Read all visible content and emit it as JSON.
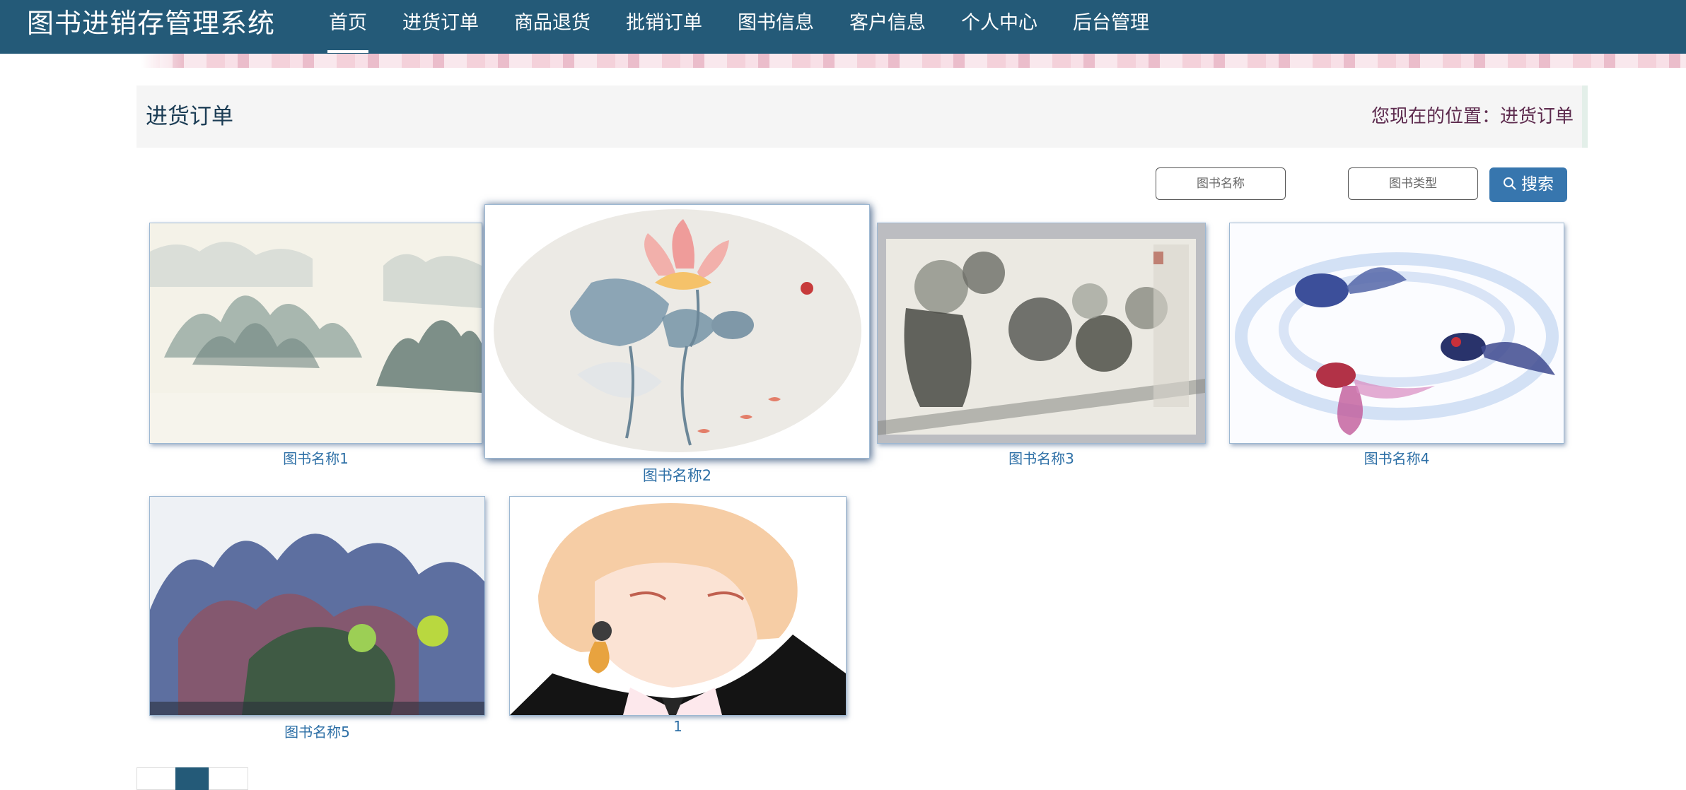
{
  "header": {
    "brand": "图书进销存管理系统",
    "nav": [
      {
        "label": "首页",
        "active": true
      },
      {
        "label": "进货订单"
      },
      {
        "label": "商品退货"
      },
      {
        "label": "批销订单"
      },
      {
        "label": "图书信息"
      },
      {
        "label": "客户信息"
      },
      {
        "label": "个人中心"
      },
      {
        "label": "后台管理"
      }
    ]
  },
  "page": {
    "title": "进货订单",
    "location": "您现在的位置：进货订单"
  },
  "search": {
    "name_placeholder": "图书名称",
    "type_placeholder": "图书类型",
    "button_label": "搜索"
  },
  "items": [
    {
      "caption": "图书名称1",
      "image": "landscape-mist-painting"
    },
    {
      "caption": "图书名称2",
      "image": "lotus-painting"
    },
    {
      "caption": "图书名称3",
      "image": "chrysanthemum-vase-painting"
    },
    {
      "caption": "图书名称4",
      "image": "goldfish-painting"
    },
    {
      "caption": "图书名称5",
      "image": "mountain-village-painting"
    },
    {
      "caption": "1",
      "image": "anime-portrait"
    }
  ],
  "colors": {
    "nav_bg": "#245a78",
    "accent": "#3776ae",
    "caption": "#2d6fa6"
  }
}
